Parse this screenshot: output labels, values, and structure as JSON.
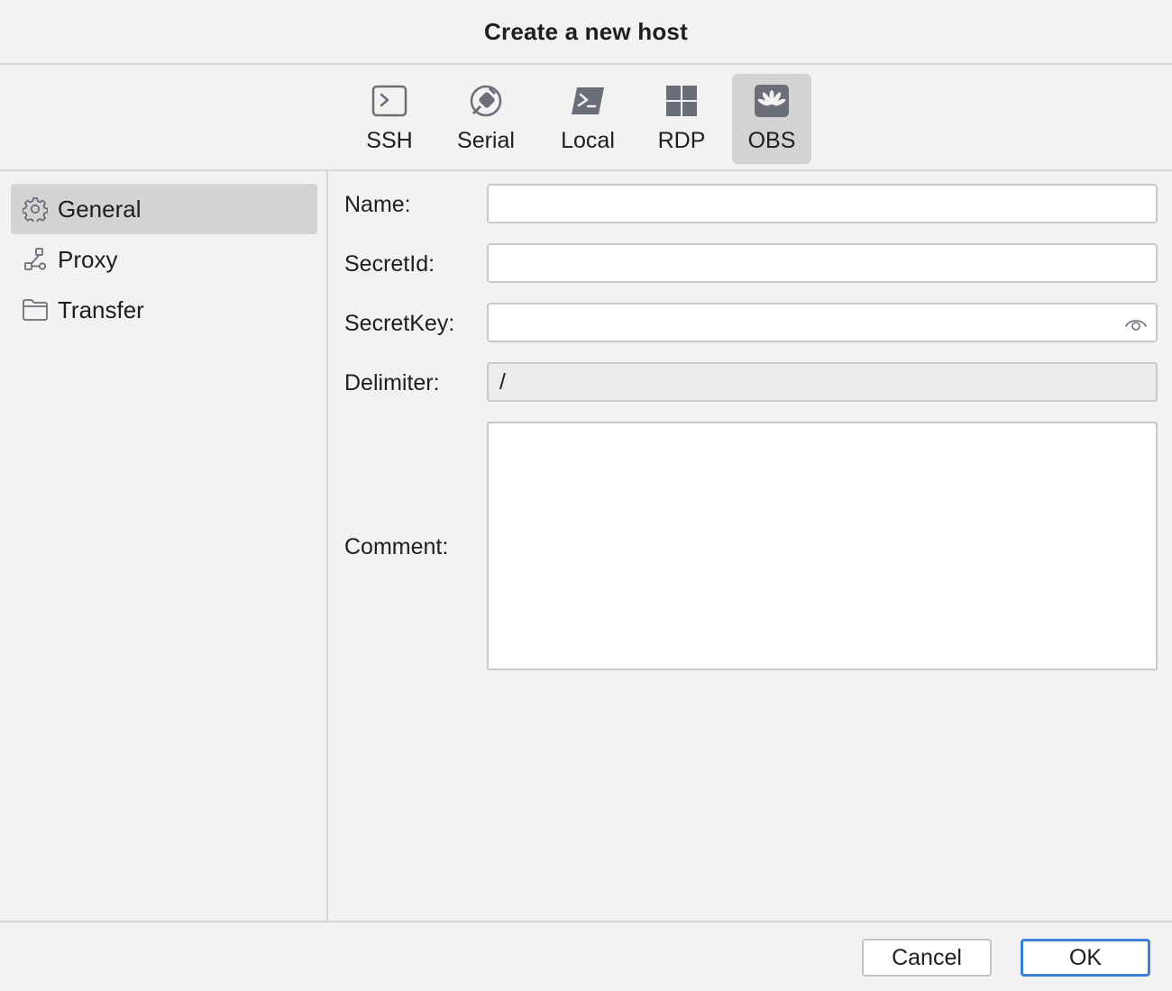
{
  "window": {
    "title": "Create a new host"
  },
  "host_types": [
    {
      "label": "SSH",
      "icon": "terminal-icon",
      "selected": false
    },
    {
      "label": "Serial",
      "icon": "plug-icon",
      "selected": false
    },
    {
      "label": "Local",
      "icon": "powershell-icon",
      "selected": false
    },
    {
      "label": "RDP",
      "icon": "windows-icon",
      "selected": false
    },
    {
      "label": "OBS",
      "icon": "huawei-icon",
      "selected": true
    }
  ],
  "sidebar": {
    "items": [
      {
        "label": "General",
        "icon": "gear-icon",
        "selected": true
      },
      {
        "label": "Proxy",
        "icon": "network-icon",
        "selected": false
      },
      {
        "label": "Transfer",
        "icon": "folder-icon",
        "selected": false
      }
    ]
  },
  "form": {
    "name_label": "Name:",
    "name_value": "",
    "secretid_label": "SecretId:",
    "secretid_value": "",
    "secretkey_label": "SecretKey:",
    "secretkey_value": "",
    "delimiter_label": "Delimiter:",
    "delimiter_value": "/",
    "comment_label": "Comment:",
    "comment_value": ""
  },
  "footer": {
    "cancel_label": "Cancel",
    "ok_label": "OK"
  },
  "colors": {
    "background": "#f2f2f2",
    "selected": "#d3d3d3",
    "icon": "#6b6e78",
    "ok_border": "#3d7fdc"
  }
}
